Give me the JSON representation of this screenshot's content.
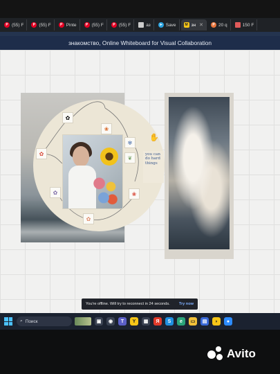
{
  "browser": {
    "tabs": [
      {
        "label": "(55) F",
        "icon": "pinterest-icon",
        "color": "#e60023",
        "active": false
      },
      {
        "label": "(55) F",
        "icon": "pinterest-icon",
        "color": "#e60023",
        "active": false
      },
      {
        "label": "Pinte",
        "icon": "pinterest-icon",
        "color": "#e60023",
        "active": false
      },
      {
        "label": "(55) F",
        "icon": "pinterest-icon",
        "color": "#e60023",
        "active": false
      },
      {
        "label": "(55) F",
        "icon": "pinterest-icon",
        "color": "#e60023",
        "active": false
      },
      {
        "label": "аз",
        "icon": "document-icon",
        "color": "#cccccc",
        "active": false
      },
      {
        "label": "Save",
        "icon": "telegram-icon",
        "color": "#2aa3e0",
        "active": false
      },
      {
        "label": "зн",
        "icon": "miro-icon",
        "color": "#f5c518",
        "active": true
      },
      {
        "label": "20 q",
        "icon": "pinterest-icon",
        "color": "#e8743b",
        "active": false
      },
      {
        "label": "150 F",
        "icon": "generic-tab-icon",
        "color": "#e05a5a",
        "active": false
      }
    ]
  },
  "page": {
    "title": "знакомство, Online Whiteboard for Visual Collaboration"
  },
  "board": {
    "quote_text": "you can do hard things",
    "hand_cursor_icon": "hand-cursor-icon"
  },
  "toast": {
    "message": "You're offline. Will try to reconnect in 24 seconds.",
    "action": "Try now"
  },
  "taskbar": {
    "search_label": "Поиск",
    "icons": [
      "file-explorer-icon",
      "camera-icon",
      "teams-icon",
      "yandex-browser-icon",
      "store-icon",
      "yandex-icon",
      "skype-icon",
      "edge-icon",
      "folder-icon",
      "photos-icon",
      "app-icon",
      "zoom-icon"
    ]
  },
  "watermark": {
    "text": "Avito"
  }
}
